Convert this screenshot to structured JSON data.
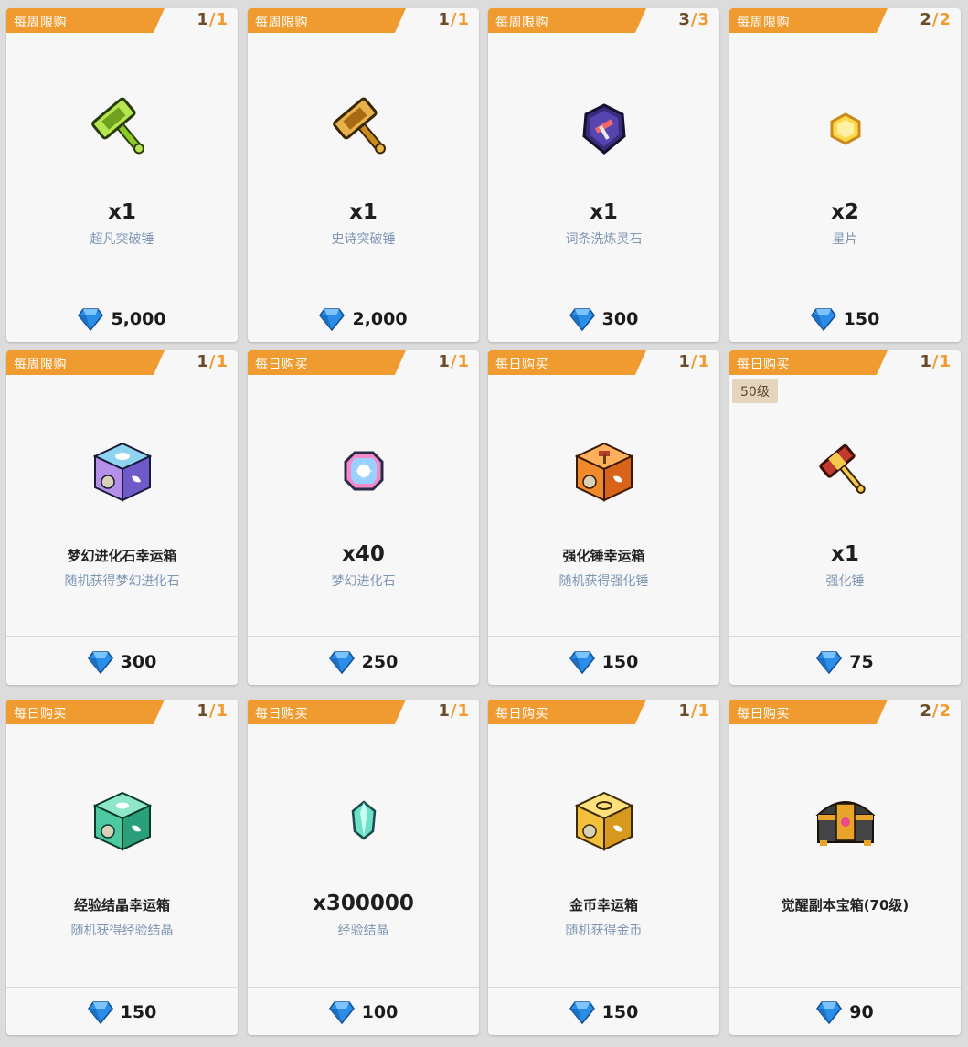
{
  "theme": {
    "banner": "#ef9b30",
    "count_used": "#6b4a28",
    "count_max": "#ef9b30",
    "sub_text": "#7f96b4",
    "gem": "#2a8de8"
  },
  "items": [
    {
      "tag": "每周限购",
      "used": "1",
      "max": "1",
      "qty": "x1",
      "title": "",
      "sub": "超凡突破锤",
      "price": "5,000",
      "icon": "green-hammer-icon",
      "level": ""
    },
    {
      "tag": "每周限购",
      "used": "1",
      "max": "1",
      "qty": "x1",
      "title": "",
      "sub": "史诗突破锤",
      "price": "2,000",
      "icon": "gold-hammer-icon",
      "level": ""
    },
    {
      "tag": "每周限购",
      "used": "3",
      "max": "3",
      "qty": "x1",
      "title": "",
      "sub": "词条洗炼灵石",
      "price": "300",
      "icon": "refine-stone-icon",
      "level": ""
    },
    {
      "tag": "每周限购",
      "used": "2",
      "max": "2",
      "qty": "x2",
      "title": "",
      "sub": "星片",
      "price": "150",
      "icon": "star-shard-icon",
      "level": ""
    },
    {
      "tag": "每周限购",
      "used": "1",
      "max": "1",
      "qty": "",
      "title": "梦幻进化石幸运箱",
      "sub": "随机获得梦幻进化石",
      "price": "300",
      "icon": "dream-lucky-box-icon",
      "level": ""
    },
    {
      "tag": "每日购买",
      "used": "1",
      "max": "1",
      "qty": "x40",
      "title": "",
      "sub": "梦幻进化石",
      "price": "250",
      "icon": "dream-stone-icon",
      "level": ""
    },
    {
      "tag": "每日购买",
      "used": "1",
      "max": "1",
      "qty": "",
      "title": "强化锤幸运箱",
      "sub": "随机获得强化锤",
      "price": "150",
      "icon": "hammer-lucky-box-icon",
      "level": ""
    },
    {
      "tag": "每日购买",
      "used": "1",
      "max": "1",
      "qty": "x1",
      "title": "",
      "sub": "强化锤",
      "price": "75",
      "icon": "enhance-hammer-icon",
      "level": "50级"
    },
    {
      "tag": "每日购买",
      "used": "1",
      "max": "1",
      "qty": "",
      "title": "经验结晶幸运箱",
      "sub": "随机获得经验结晶",
      "price": "150",
      "icon": "exp-lucky-box-icon",
      "level": ""
    },
    {
      "tag": "每日购买",
      "used": "1",
      "max": "1",
      "qty": "x300000",
      "title": "",
      "sub": "经验结晶",
      "price": "100",
      "icon": "exp-crystal-icon",
      "level": ""
    },
    {
      "tag": "每日购买",
      "used": "1",
      "max": "1",
      "qty": "",
      "title": "金币幸运箱",
      "sub": "随机获得金币",
      "price": "150",
      "icon": "gold-lucky-box-icon",
      "level": ""
    },
    {
      "tag": "每日购买",
      "used": "2",
      "max": "2",
      "qty": "",
      "title": "觉醒副本宝箱(70级)",
      "sub": "",
      "price": "90",
      "icon": "awaken-chest-icon",
      "level": ""
    }
  ]
}
